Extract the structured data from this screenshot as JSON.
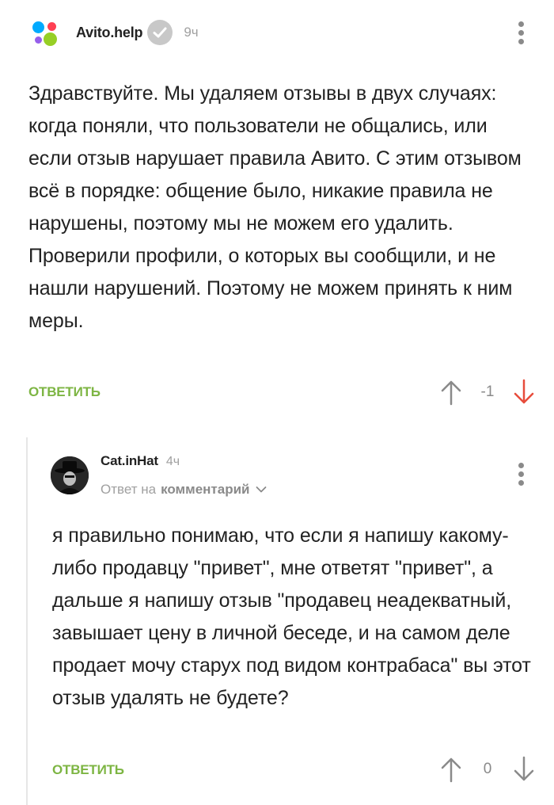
{
  "comments": [
    {
      "author": "Avito.help",
      "time": "9ч",
      "text": "Здравствуйте. Мы удаляем отзывы в двух случаях: когда поняли, что пользователи не общались, или если отзыв нарушает правила Авито. С этим отзывом всё в порядке: общение было, никакие правила не нарушены, поэтому мы не можем его удалить. Проверили профили, о которых вы сообщили, и не нашли нарушений. Поэтому не можем принять к ним меры.",
      "reply_label": "ОТВЕТИТЬ",
      "score": "-1",
      "downvote_color": "#e74c3c"
    },
    {
      "author": "Cat.inHat",
      "time": "4ч",
      "reply_to_prefix": "Ответ на",
      "reply_to_target": "комментарий",
      "text": "я правильно понимаю, что если я напишу какому-либо продавцу \"привет\", мне ответят \"привет\", а дальше я напишу отзыв \"продавец неадекватный, завышает цену в личной беседе, и на самом деле продает мочу старух под видом контрабаса\" вы этот отзыв удалять не будете?",
      "reply_label": "ОТВЕТИТЬ",
      "score": "0"
    }
  ],
  "colors": {
    "reply_green": "#7db543",
    "text": "#222222",
    "muted": "#a0a0a0"
  },
  "icons": [
    "avito-logo",
    "verified-check-icon",
    "more-vert-icon",
    "arrow-up-icon",
    "arrow-down-icon",
    "chevron-down-icon"
  ]
}
